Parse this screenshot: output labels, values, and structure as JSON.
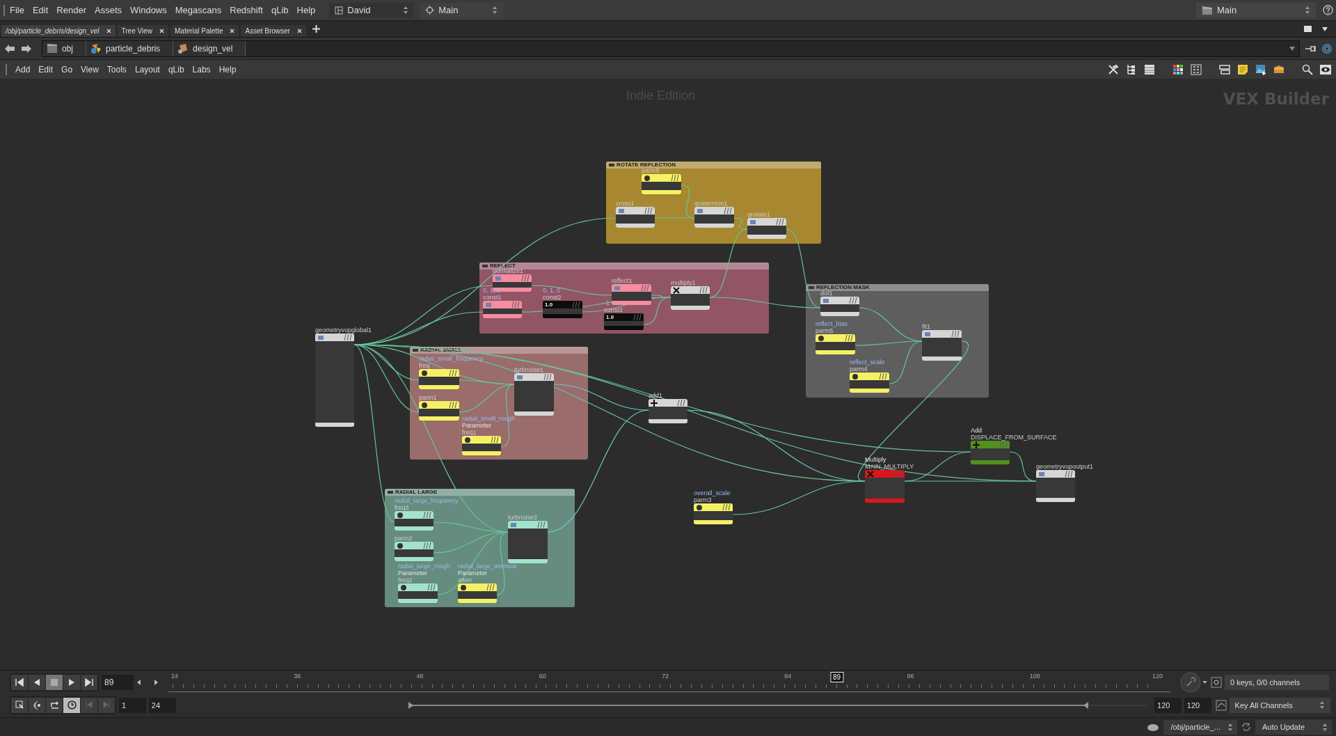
{
  "menu_bar": {
    "items": [
      "File",
      "Edit",
      "Render",
      "Assets",
      "Windows",
      "Megascans",
      "Redshift",
      "qLib",
      "Help"
    ],
    "desktop": "David",
    "context": "Main",
    "right_context": "Main"
  },
  "tabs": [
    {
      "label": "/obj/particle_debris/design_vel",
      "selected": true
    },
    {
      "label": "Tree View",
      "selected": false
    },
    {
      "label": "Material Palette",
      "selected": false
    },
    {
      "label": "Asset Browser",
      "selected": false
    }
  ],
  "path": [
    "obj",
    "particle_debris",
    "design_vel"
  ],
  "pane_menu": [
    "Add",
    "Edit",
    "Go",
    "View",
    "Tools",
    "Layout",
    "qLib",
    "Labs",
    "Help"
  ],
  "network": {
    "edition": "Indie Edition",
    "context_label": "VEX Builder",
    "boxes": [
      {
        "title": "ROTATE REFLECTION",
        "color": "#a7872f"
      },
      {
        "title": "REFLECT",
        "color": "#925566"
      },
      {
        "title": "RADIAL SMALL",
        "color": "#9a6c6b"
      },
      {
        "title": "REFLECTION MASK",
        "color": "#5e5e5e"
      },
      {
        "title": "RADIAL LARGE",
        "color": "#658c7e"
      }
    ],
    "nodes": [
      {
        "name": "parm6",
        "kind": "parm",
        "color": "#f6f163"
      },
      {
        "name": "cross1",
        "kind": "op",
        "color": "#d6d6d6"
      },
      {
        "name": "quaternion1",
        "kind": "op",
        "color": "#d6d6d6"
      },
      {
        "name": "qrotate1",
        "kind": "op",
        "color": "#d6d6d6"
      },
      {
        "name": "normalize1",
        "kind": "op",
        "color": "#f58ca2"
      },
      {
        "name": "const1",
        "kind": "op",
        "color": "#f58ca2",
        "value": "0, 1, 0"
      },
      {
        "name": "const2",
        "kind": "const",
        "color": "#0c0c0c",
        "value": "0, 1, 0",
        "display": "1.0"
      },
      {
        "name": "reflect1",
        "kind": "op",
        "color": "#f58ca2"
      },
      {
        "name": "const3",
        "kind": "const",
        "color": "#0c0c0c",
        "value": "-1",
        "display": "1.0"
      },
      {
        "name": "multiply1",
        "kind": "multiply",
        "color": "#d6d6d6"
      },
      {
        "name": "geometryvopglobal1",
        "kind": "op",
        "color": "#d6d6d6"
      },
      {
        "name": "freq",
        "kind": "parm",
        "color": "#f6f163",
        "param": "radial_small_frequency"
      },
      {
        "name": "parm1",
        "kind": "parm",
        "color": "#f6f163"
      },
      {
        "name": "freq1",
        "kind": "parm",
        "color": "#f6f163",
        "param": "radial_small_rough",
        "type": "Parameter"
      },
      {
        "name": "turbnoise1",
        "kind": "op",
        "color": "#d6d6d6"
      },
      {
        "name": "add1",
        "kind": "add",
        "color": "#d6d6d6"
      },
      {
        "name": "dot1",
        "kind": "op",
        "color": "#d6d6d6"
      },
      {
        "name": "parm5",
        "kind": "parm",
        "color": "#f6f163",
        "param": "reflect_bias"
      },
      {
        "name": "parm4",
        "kind": "parm",
        "color": "#f6f163",
        "param": "reflect_scale"
      },
      {
        "name": "fit1",
        "kind": "op",
        "color": "#d6d6d6"
      },
      {
        "name": "freq3",
        "kind": "parm",
        "color": "#a3e3cc",
        "param": "radial_large_frequency"
      },
      {
        "name": "parm2",
        "kind": "parm",
        "color": "#a3e3cc"
      },
      {
        "name": "freq2",
        "kind": "parm",
        "color": "#a3e3cc",
        "param": "radial_large_rough",
        "type": "Parameter"
      },
      {
        "name": "atten",
        "kind": "parm",
        "color": "#f6f163",
        "param": "radial_large_attenuat",
        "type": "Parameter"
      },
      {
        "name": "turbnoise2",
        "kind": "op",
        "color": "#a3e3cc"
      },
      {
        "name": "parm3",
        "kind": "parm",
        "color": "#f6f163",
        "param": "overall_scale"
      },
      {
        "name": "MAIN_MULTIPLY",
        "kind": "multiply",
        "color": "#d8161c",
        "type": "Multiply"
      },
      {
        "name": "DISPLACE_FROM_SURFACE",
        "kind": "add",
        "color": "#52901f",
        "type": "Add"
      },
      {
        "name": "geometryvopoutput1",
        "kind": "op",
        "color": "#d6d6d6"
      }
    ]
  },
  "timeline": {
    "frame": "89",
    "ticks": [
      "24",
      "36",
      "48",
      "60",
      "72",
      "84",
      "96",
      "108",
      "120"
    ],
    "playhead": {
      "label": "89",
      "level": 0.677
    },
    "start": "1",
    "range_start": "24",
    "range_slider": {
      "level": 0.92
    },
    "range_end": "120",
    "end": "120",
    "keys": "0 keys, 0/0 channels",
    "key_button": "Key All Channels"
  },
  "status_bar": {
    "path": "/obj/particle_...",
    "update": "Auto Update"
  }
}
